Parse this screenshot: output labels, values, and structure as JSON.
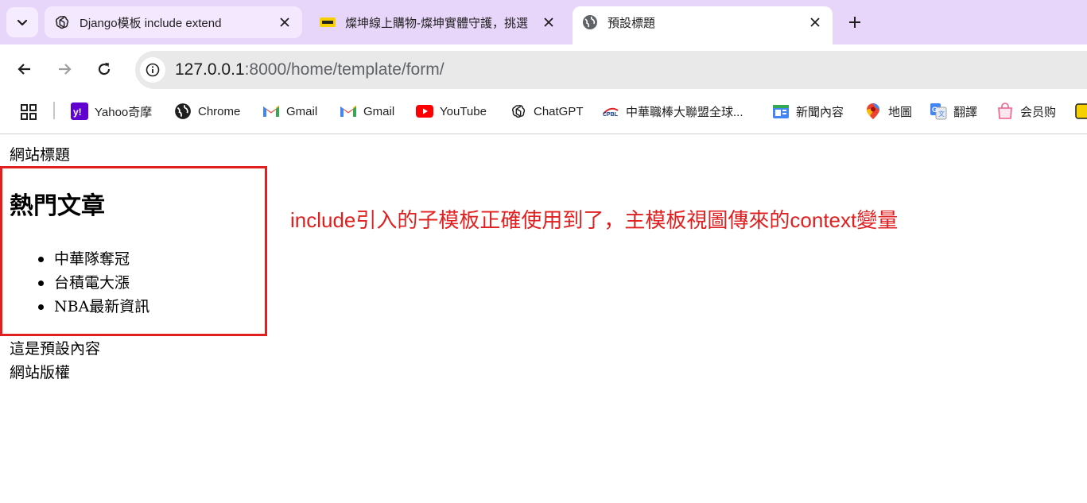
{
  "browser": {
    "tabs": [
      {
        "title": "Django模板 include extend",
        "favicon": "chatgpt-icon",
        "active": false
      },
      {
        "title": "燦坤線上購物-燦坤實體守護，挑選",
        "favicon": "tkec-icon",
        "active": false
      },
      {
        "title": "預設標題",
        "favicon": "globe-icon",
        "active": true
      }
    ],
    "url": {
      "host": "127.0.0.1",
      "rest": ":8000/home/template/form/"
    },
    "bookmarks": [
      {
        "label": "Yahoo奇摩",
        "icon": "yahoo-icon"
      },
      {
        "label": "Chrome",
        "icon": "globe-icon"
      },
      {
        "label": "Gmail",
        "icon": "gmail-icon"
      },
      {
        "label": "Gmail",
        "icon": "gmail-icon"
      },
      {
        "label": "YouTube",
        "icon": "youtube-icon"
      },
      {
        "label": "ChatGPT",
        "icon": "chatgpt-icon"
      },
      {
        "label": "中華職棒大聯盟全球...",
        "icon": "cpbl-icon"
      },
      {
        "label": "新聞內容",
        "icon": "news-icon"
      },
      {
        "label": "地圖",
        "icon": "maps-icon"
      },
      {
        "label": "翻譯",
        "icon": "translate-icon"
      },
      {
        "label": "会员购",
        "icon": "shop-icon"
      }
    ]
  },
  "page": {
    "site_title": "網站標題",
    "hot_articles": {
      "heading": "熱門文章",
      "items": [
        "中華隊奪冠",
        "台積電大漲",
        "NBA最新資訊"
      ]
    },
    "annotation": "include引入的子模板正確使用到了，主模板視圖傳來的context變量",
    "default_content": "這是預設內容",
    "copyright": "網站版權"
  },
  "colors": {
    "tabstrip_bg": "#e8d6fa",
    "annotation_red": "#e02020",
    "omnibox_bg": "#e9e9e9"
  }
}
